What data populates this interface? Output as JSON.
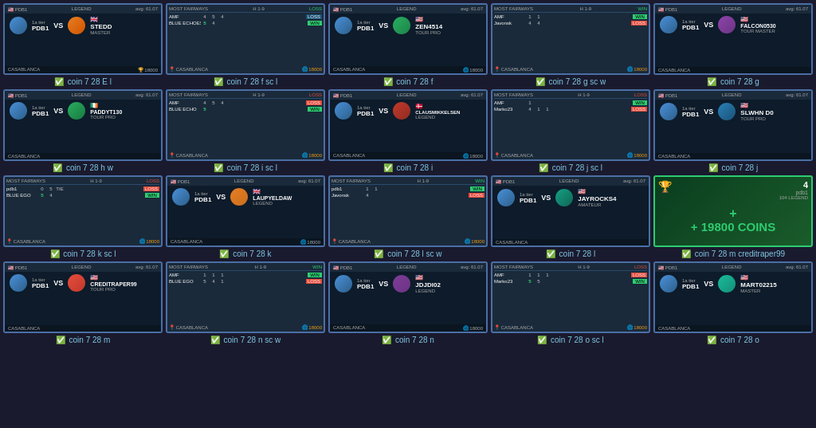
{
  "cards": [
    {
      "id": "card-1",
      "type": "match",
      "player1": "PDB1",
      "player1_tier": "LEGEND",
      "player2": "STEDD",
      "player2_flag": "gb",
      "player2_tier": "MASTER",
      "label": "coin 7 28 E l",
      "location": "CASABLANCA"
    },
    {
      "id": "card-2",
      "type": "scorecard",
      "label": "coin 7 28 f sc l",
      "location": "CASABLANCA",
      "prize": "18000"
    },
    {
      "id": "card-3",
      "type": "match",
      "player1": "PDB1",
      "player1_tier": "LEGEND",
      "player2": "ZEN4514",
      "player2_flag": "us",
      "player2_tier": "TOUR PRO",
      "label": "coin 7 28 f",
      "location": "CASABLANCA",
      "prize": "18000"
    },
    {
      "id": "card-4",
      "type": "scorecard",
      "label": "coin 7 28 g sc w",
      "location": "CASABLANCA",
      "prize": "18000"
    },
    {
      "id": "card-5",
      "type": "match",
      "player1": "PDB1",
      "player1_tier": "LEGEND",
      "player2": "FALCON0530",
      "player2_flag": "us",
      "player2_tier": "TOUR MASTER",
      "label": "coin 7 28 g",
      "location": "CASABLANCA"
    },
    {
      "id": "card-6",
      "type": "match",
      "player1": "PDB1",
      "player1_tier": "LEGEND",
      "player2": "PADDYT130",
      "player2_flag": "ie",
      "player2_tier": "TOUR PRO",
      "label": "coin 7 28 h w",
      "location": "CASABLANCA"
    },
    {
      "id": "card-7",
      "type": "scorecard",
      "label": "coin 7 28 i sc l",
      "location": "CASABLANCA",
      "prize": "18000"
    },
    {
      "id": "card-8",
      "type": "match",
      "player1": "PDB1",
      "player1_tier": "LEGEND",
      "player2": "CLAUSMIKKELSEN",
      "player2_flag": "dk",
      "player2_tier": "LEGEND",
      "label": "coin 7 28 i",
      "location": "CASABLANCA",
      "prize": "18000"
    },
    {
      "id": "card-9",
      "type": "scorecard",
      "label": "coin 7 28 j sc l",
      "location": "CASABLANCA",
      "prize": "18000"
    },
    {
      "id": "card-10",
      "type": "match",
      "player1": "PDB1",
      "player1_tier": "LEGEND",
      "player2": "SLWHN D0",
      "player2_flag": "us",
      "player2_tier": "TOUR PRO",
      "label": "coin 7 28 j",
      "location": "CASABLANCA"
    },
    {
      "id": "card-11",
      "type": "scorecard",
      "label": "coin 7 28 k sc l",
      "location": "CASABLANCA",
      "prize": "18000"
    },
    {
      "id": "card-12",
      "type": "match",
      "player1": "PDB1",
      "player1_tier": "LEGEND",
      "player2": "LAUPYELDAW",
      "player2_flag": "gb",
      "player2_tier": "LEGEND",
      "label": "coin 7 28 k",
      "location": "CASABLANCA",
      "prize": "18000"
    },
    {
      "id": "card-13",
      "type": "scorecard",
      "label": "coin 7 28 l sc w",
      "location": "CASABLANCA",
      "prize": "18000"
    },
    {
      "id": "card-14",
      "type": "match",
      "player1": "PDB1",
      "player1_tier": "LEGEND",
      "player2": "JAYROCKS4",
      "player2_flag": "us",
      "player2_tier": "AMATEUR",
      "label": "coin 7 28 l",
      "location": "CASABLANCA"
    },
    {
      "id": "card-15",
      "type": "coins",
      "coins": "19800",
      "coins_display": "+ 19800 COINS",
      "player": "pdb1",
      "tier": "LEGEND",
      "number": "4",
      "label": "coin 7 28 m creditraper99"
    },
    {
      "id": "card-16",
      "type": "match",
      "player1": "PDB1",
      "player1_tier": "LEGEND",
      "player2": "CREDITRAPER99",
      "player2_flag": "us",
      "player2_tier": "TOUR PRO",
      "label": "coin 7 28 m",
      "location": "CASABLANCA"
    },
    {
      "id": "card-17",
      "type": "scorecard",
      "label": "coin 7 28 n sc w",
      "location": "CASABLANCA",
      "prize": "18000"
    },
    {
      "id": "card-18",
      "type": "match",
      "player1": "PDB1",
      "player1_tier": "LEGEND",
      "player2": "JDJDI02",
      "player2_flag": "us",
      "player2_tier": "LEGEND",
      "label": "coin 7 28 n",
      "location": "CASABLANCA",
      "prize": "18000"
    },
    {
      "id": "card-19",
      "type": "scorecard",
      "label": "coin 7 28 o sc l",
      "location": "CASABLANCA",
      "prize": "18000"
    },
    {
      "id": "card-20",
      "type": "match",
      "player1": "PDB1",
      "player1_tier": "LEGEND",
      "player2": "MART02215",
      "player2_flag": "us",
      "player2_tier": "MASTER",
      "label": "coin 7 28 o",
      "location": "CASABLANCA"
    }
  ]
}
